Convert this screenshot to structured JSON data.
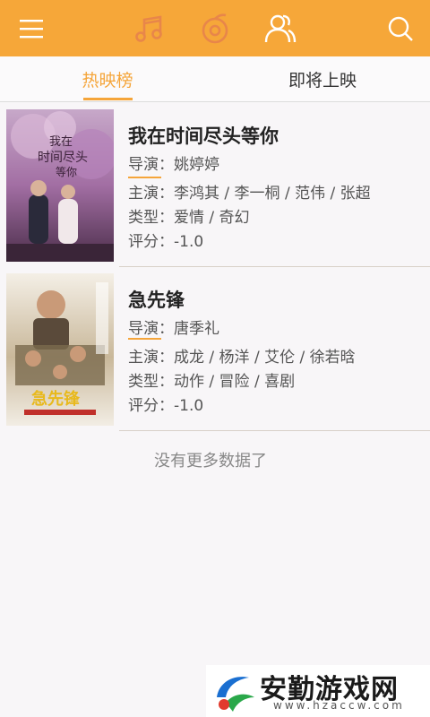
{
  "topbar": {
    "menu_icon": "menu-icon",
    "music_icon": "music-note-icon",
    "film_icon": "film-reel-icon",
    "people_icon": "people-icon",
    "search_icon": "search-icon",
    "accent": "#f6a739"
  },
  "tabs": [
    {
      "label": "热映榜",
      "active": true
    },
    {
      "label": "即将上映",
      "active": false
    }
  ],
  "movies": [
    {
      "title": "我在时间尽头等你",
      "director_label": "导演：",
      "director": "姚婷婷",
      "cast_label": "主演：",
      "cast": "李鸿其 / 李一桐 / 范伟 / 张超",
      "genre_label": "类型：",
      "genre": "爱情 / 奇幻",
      "rating_label": "评分：",
      "rating": "-1.0"
    },
    {
      "title": "急先锋",
      "director_label": "导演：",
      "director": "唐季礼",
      "cast_label": "主演：",
      "cast": "成龙 / 杨洋 / 艾伦 / 徐若晗",
      "genre_label": "类型：",
      "genre": "动作 / 冒险 / 喜剧",
      "rating_label": "评分：",
      "rating": "-1.0"
    }
  ],
  "footer_text": "没有更多数据了",
  "watermark": {
    "text": "安勤游戏网",
    "url": "www.hzaccw.com"
  }
}
